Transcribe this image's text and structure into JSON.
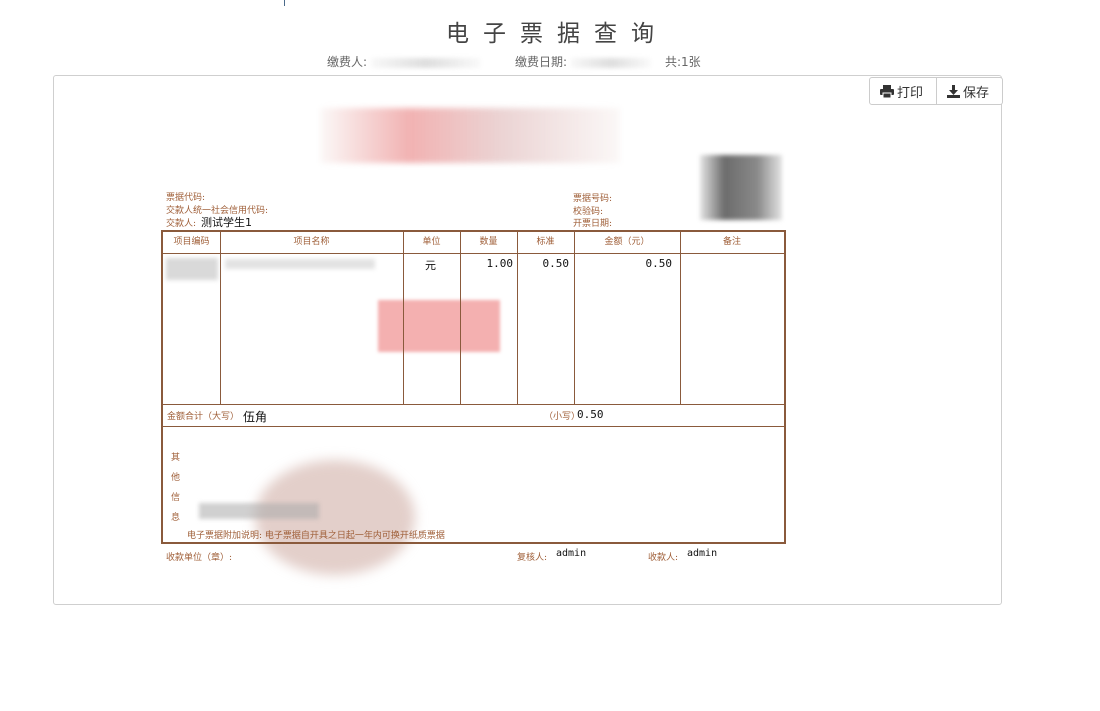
{
  "page": {
    "title": "电子票据查询",
    "payer_label": "缴费人:",
    "date_label": "缴费日期:",
    "total": "共:1张"
  },
  "toolbar": {
    "print_label": "打印",
    "save_label": "保存"
  },
  "invoice": {
    "labels": {
      "code": "票据代码:",
      "payer_credit_code": "交款人统一社会信用代码:",
      "payer": "交款人:",
      "number": "票据号码:",
      "check_code": "校验码:",
      "issue_date": "开票日期:"
    },
    "payer_name": "测试学生1",
    "columns": [
      "项目编码",
      "项目名称",
      "单位",
      "数量",
      "标准",
      "金额（元）",
      "备注"
    ],
    "rows": [
      {
        "unit": "元",
        "quantity": "1.00",
        "standard": "0.50",
        "amount": "0.50"
      }
    ],
    "total_upper_label": "金额合计（大写）",
    "total_upper": "伍角",
    "total_lower_label": "（小写）",
    "total_lower": "0.50",
    "other_info_label": [
      "其",
      "他",
      "信",
      "息"
    ],
    "note": "电子票据附加说明: 电子票据自开具之日起一年内可换开纸质票据",
    "receiver_unit_label": "收款单位（章）:",
    "reviewer_label": "复核人:",
    "reviewer": "admin",
    "collector_label": "收款人:",
    "collector": "admin"
  },
  "colors": {
    "invoice_border": "#8a5a3c",
    "invoice_label": "#a0603a"
  }
}
